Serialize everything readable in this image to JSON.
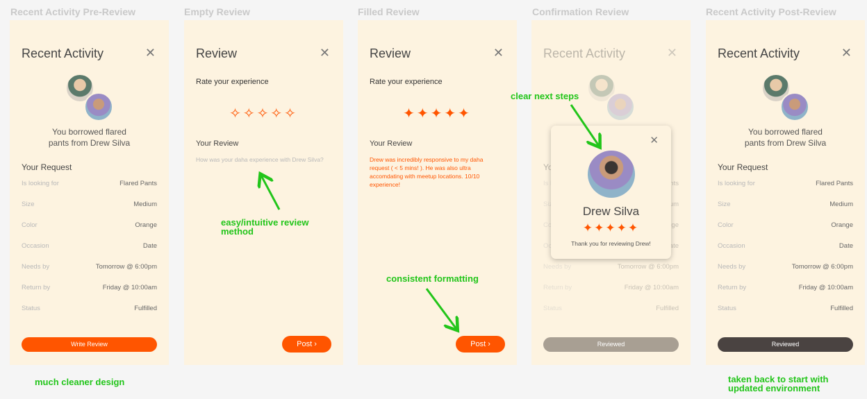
{
  "frames": {
    "f1": {
      "title": "Recent Activity Pre-Review"
    },
    "f2": {
      "title": "Empty Review"
    },
    "f3": {
      "title": "Filled Review"
    },
    "f4": {
      "title": "Confirmation Review"
    },
    "f5": {
      "title": "Recent Activity Post-Review"
    }
  },
  "recent": {
    "header": "Recent Activity",
    "borrowed_line1": "You borrowed flared",
    "borrowed_line2": "pants from Drew Silva",
    "request_title": "Your Request",
    "rows": [
      {
        "label": "Is looking for",
        "value": "Flared Pants"
      },
      {
        "label": "Size",
        "value": "Medium"
      },
      {
        "label": "Color",
        "value": "Orange"
      },
      {
        "label": "Occasion",
        "value": "Date"
      },
      {
        "label": "Needs by",
        "value": "Tomorrow @ 6:00pm"
      },
      {
        "label": "Return by",
        "value": "Friday @ 10:00am"
      },
      {
        "label": "Status",
        "value": "Fulfilled"
      }
    ],
    "write_review": "Write Review",
    "reviewed": "Reviewed"
  },
  "review": {
    "header": "Review",
    "rate_label": "Rate your experience",
    "empty_stars": "✧✧✧✧✧",
    "filled_stars": "✦✦✦✦✦",
    "your_review": "Your Review",
    "placeholder": "How was your daha experience with Drew Silva?",
    "filled_text": "Drew was incredibly responsive to my daha request ( < 5 mins! ). He was also ultra accomdating with meetup locations. 10/10 experience!",
    "post": "Post  ›"
  },
  "confirmation": {
    "name": "Drew Silva",
    "stars": "✦✦✦✦✦",
    "thanks": "Thank you for reviewing Drew!"
  },
  "annotations": {
    "cleaner": "much cleaner design",
    "intuitive_line1": "easy/intuitive review",
    "intuitive_line2": "method",
    "consistent": "consistent formatting",
    "next_steps": "clear next steps",
    "back_line1": "taken back to start with",
    "back_line2": "updated environment"
  },
  "colors": {
    "accent": "#ff5500",
    "annotation": "#22c51a",
    "panel": "#fdf3e0"
  },
  "icons": {
    "close": "close-icon",
    "star": "star-icon",
    "arrow": "arrow-icon"
  }
}
